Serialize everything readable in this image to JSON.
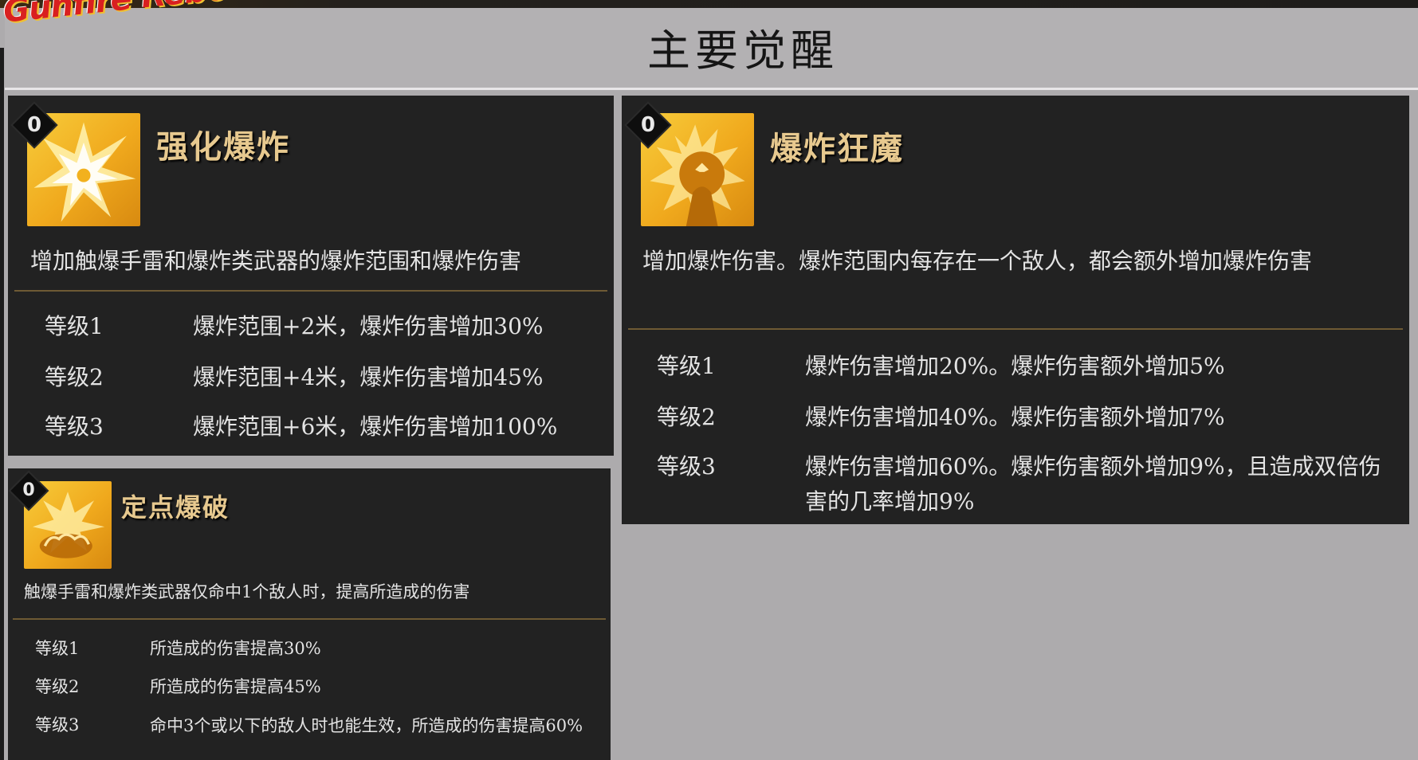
{
  "logo": {
    "text": "Gunfire Reborn"
  },
  "header": {
    "title": "主要觉醒"
  },
  "cards": [
    {
      "badge": "0",
      "icon": "explosion-burst-icon",
      "name": "强化爆炸",
      "desc": "增加触爆手雷和爆炸类武器的爆炸范围和爆炸伤害",
      "levels": [
        {
          "label": "等级1",
          "effect": "爆炸范围+2米，爆炸伤害增加30%"
        },
        {
          "label": "等级2",
          "effect": "爆炸范围+4米，爆炸伤害增加45%"
        },
        {
          "label": "等级3",
          "effect": "爆炸范围+6米，爆炸伤害增加100%"
        }
      ]
    },
    {
      "badge": "0",
      "icon": "explosion-maniac-icon",
      "name": "爆炸狂魔",
      "desc": "增加爆炸伤害。爆炸范围内每存在一个敌人，都会额外增加爆炸伤害",
      "levels": [
        {
          "label": "等级1",
          "effect": "爆炸伤害增加20%。爆炸伤害额外增加5%"
        },
        {
          "label": "等级2",
          "effect": "爆炸伤害增加40%。爆炸伤害额外增加7%"
        },
        {
          "label": "等级3",
          "effect": "爆炸伤害增加60%。爆炸伤害额外增加9%，且造成双倍伤害的几率增加9%"
        }
      ]
    },
    {
      "badge": "0",
      "icon": "fixed-point-blast-icon",
      "name": "定点爆破",
      "desc": "触爆手雷和爆炸类武器仅命中1个敌人时，提高所造成的伤害",
      "levels": [
        {
          "label": "等级1",
          "effect": "所造成的伤害提高30%"
        },
        {
          "label": "等级2",
          "effect": "所造成的伤害提高45%"
        },
        {
          "label": "等级3",
          "effect": "命中3个或以下的敌人时也能生效，所造成的伤害提高60%"
        }
      ]
    }
  ]
}
